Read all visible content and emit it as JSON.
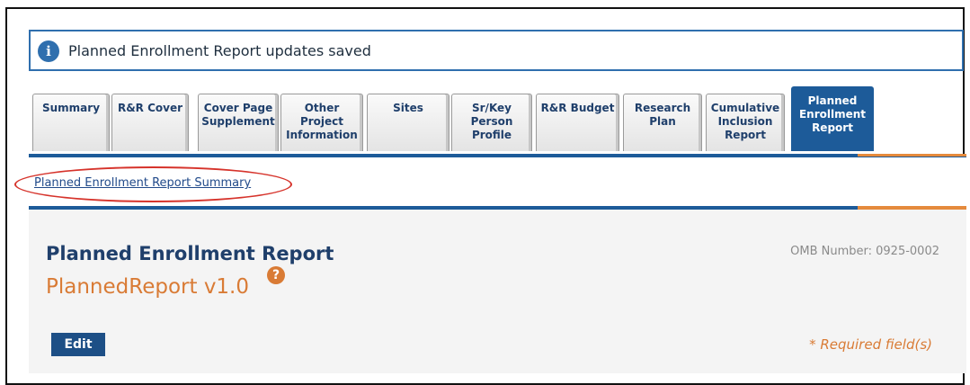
{
  "alert": {
    "message": "Planned Enrollment Report updates saved",
    "icon": "info-icon"
  },
  "tabs": [
    {
      "lines": [
        "Summary"
      ]
    },
    {
      "lines": [
        "R&R Cover"
      ]
    },
    {
      "lines": [
        "Cover Page",
        "Supplement"
      ]
    },
    {
      "lines": [
        "Other",
        "Project",
        "Information"
      ]
    },
    {
      "lines": [
        "Sites"
      ]
    },
    {
      "lines": [
        "Sr/Key",
        "Person",
        "Profile"
      ]
    },
    {
      "lines": [
        "R&R Budget"
      ]
    },
    {
      "lines": [
        "Research",
        "Plan"
      ]
    },
    {
      "lines": [
        "Cumulative",
        "Inclusion",
        "Report"
      ]
    },
    {
      "lines": [
        "Planned",
        "Enrollment",
        "Report"
      ],
      "active": true
    }
  ],
  "sublink": "Planned Enrollment Report Summary",
  "form": {
    "title": "Planned Enrollment Report",
    "subtitle": "PlannedReport v1.0",
    "help_icon": "?",
    "omb": "OMB Number: 0925-0002",
    "edit_label": "Edit",
    "required_note": "* Required field(s)"
  },
  "colors": {
    "accent": "#1d5b99",
    "orange": "#d97b35",
    "highlight": "#d6332b"
  }
}
